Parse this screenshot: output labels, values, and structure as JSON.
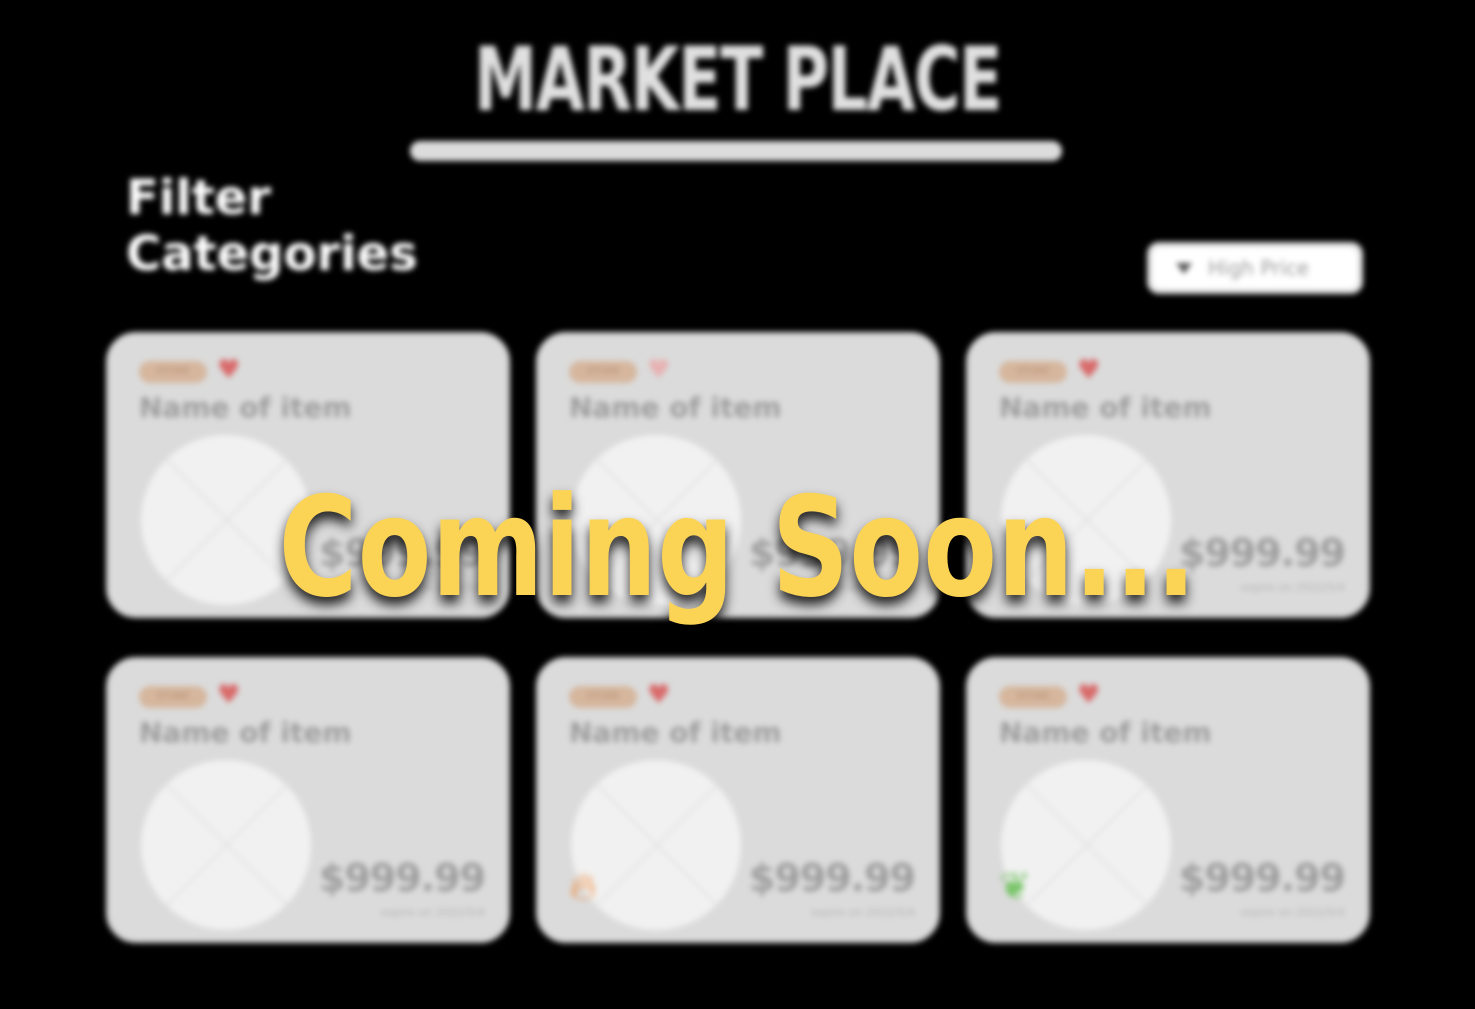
{
  "header": {
    "title": "MARKET PLACE"
  },
  "filter": {
    "label_line1": "Filter",
    "label_line2": "Categories"
  },
  "sort": {
    "selected": "High Price"
  },
  "cards": [
    {
      "badge": "STORE",
      "name": "Name of item",
      "price": "$999.99",
      "expiry": "expire on 2022/5/4",
      "heart": "filled",
      "deco": ""
    },
    {
      "badge": "STORE",
      "name": "Name of item",
      "price": "$999.99",
      "expiry": "expire on 2022/5/4",
      "heart": "outline",
      "deco": ""
    },
    {
      "badge": "STORE",
      "name": "Name of item",
      "price": "$999.99",
      "expiry": "expire on 2022/5/4",
      "heart": "filled",
      "deco": ""
    },
    {
      "badge": "STORE",
      "name": "Name of item",
      "price": "$999.99",
      "expiry": "expire on 2022/5/4",
      "heart": "filled",
      "deco": ""
    },
    {
      "badge": "STORE",
      "name": "Name of item",
      "price": "$999.99",
      "expiry": "expire on 2022/5/4",
      "heart": "filled",
      "deco": "fire-icon"
    },
    {
      "badge": "STORE",
      "name": "Name of item",
      "price": "$999.99",
      "expiry": "expire on 2022/5/4",
      "heart": "filled",
      "deco": "sprout-icon"
    }
  ],
  "overlay": {
    "message": "Coming Soon..."
  },
  "colors": {
    "background": "#000000",
    "overlay_text": "#fcd455",
    "card_bg": "#dbdbdb",
    "heart": "#d96a6a"
  }
}
